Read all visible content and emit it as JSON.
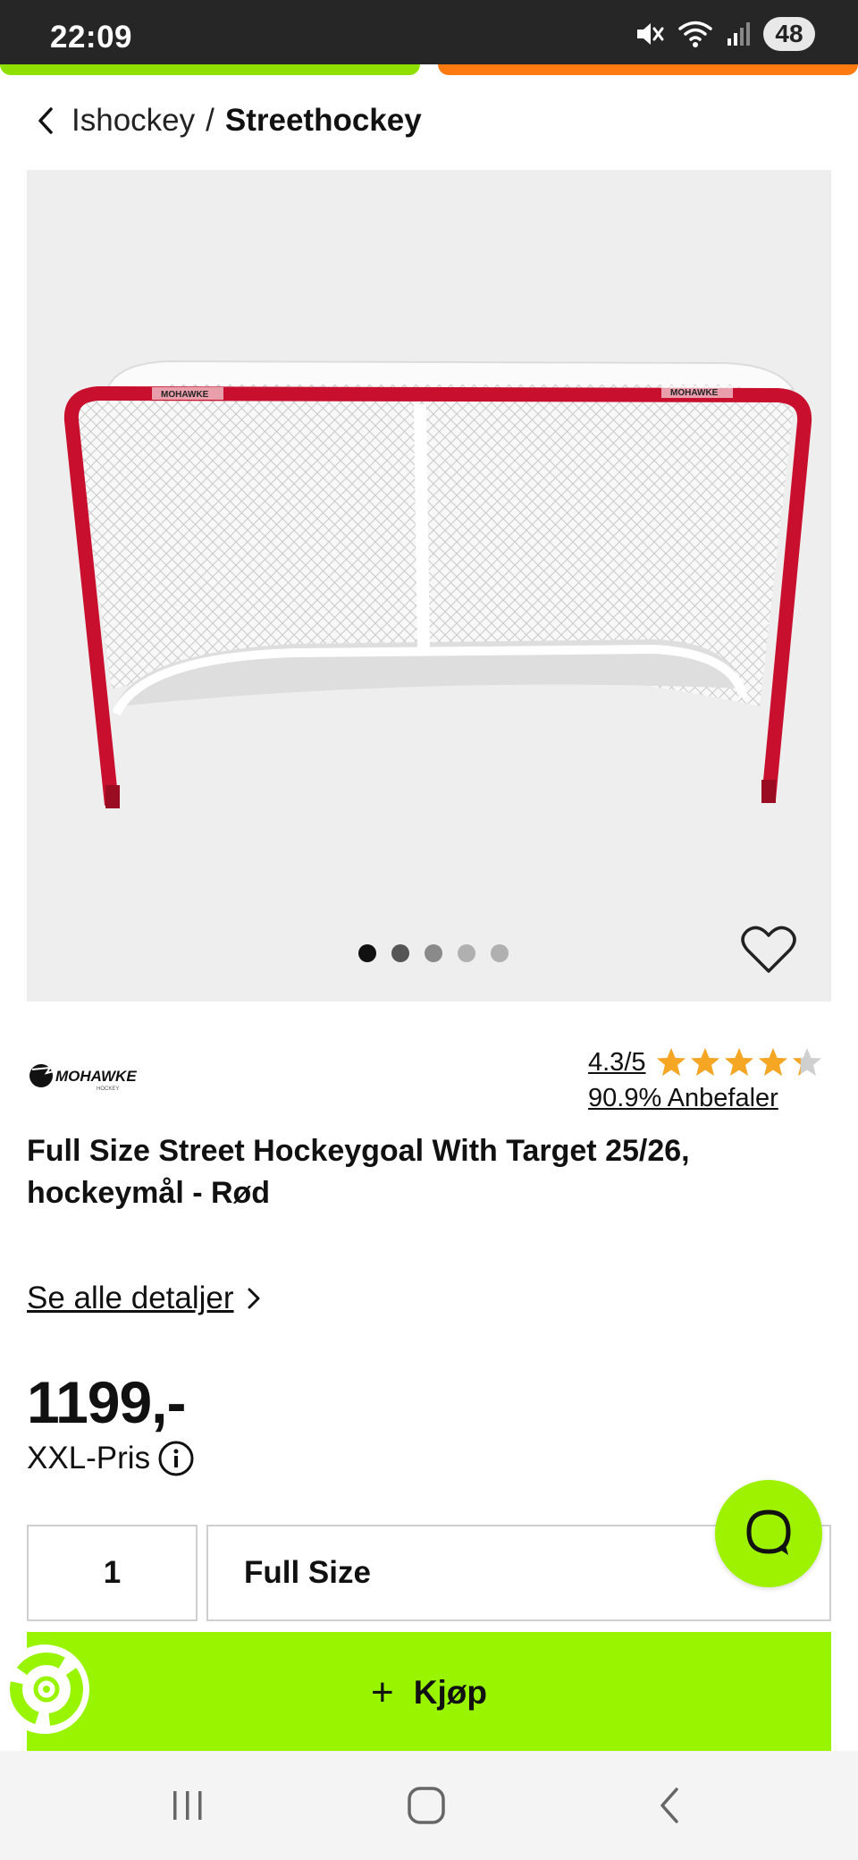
{
  "status_bar": {
    "time": "22:09",
    "battery": "48",
    "icons": [
      "mute-icon",
      "wifi-icon",
      "signal-icon"
    ]
  },
  "breadcrumb": {
    "parent": "Ishockey",
    "separator": "/",
    "current": "Streethockey"
  },
  "gallery": {
    "image_alt": "Hockey goal",
    "image_count": 5,
    "active_index": 0,
    "goal_logo": "MOHAWKE",
    "favorite_icon": "heart-outline-icon"
  },
  "product": {
    "brand": "MOHAWKE",
    "brand_sub": "HOCKEY",
    "rating": "4.3/5",
    "rating_value": 4.3,
    "stars_max": 5,
    "recommend": "90.9% Anbefaler",
    "title": "Full Size Street Hockeygoal With Target 25/26, hockeymål - Rød",
    "details_link": "Se alle detaljer",
    "price": "1199,-",
    "price_label": "XXL-Pris"
  },
  "purchase": {
    "quantity": "1",
    "size": "Full Size",
    "buy_label": "Kjøp"
  },
  "colors": {
    "accent_green": "#99f400",
    "accent_orange": "#ff7a10",
    "star": "#f5a623",
    "goal_red": "#c8102e"
  }
}
